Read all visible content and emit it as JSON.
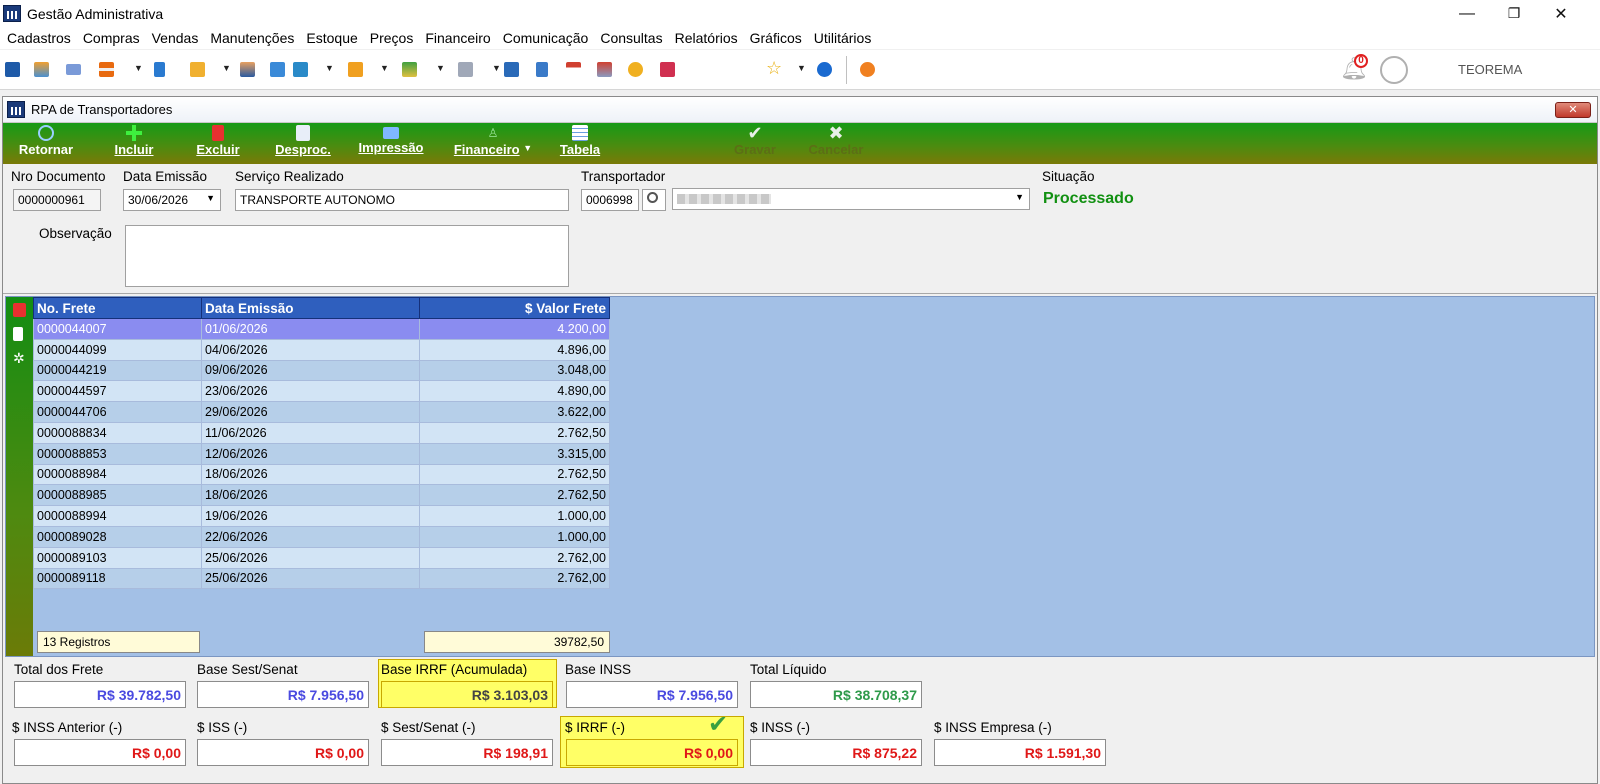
{
  "window": {
    "title": "Gestão Administrativa",
    "min": "—",
    "restore": "❐",
    "close": "✕"
  },
  "menu": [
    "Cadastros",
    "Compras",
    "Vendas",
    "Manutenções",
    "Estoque",
    "Preços",
    "Financeiro",
    "Comunicação",
    "Consultas",
    "Relatórios",
    "Gráficos",
    "Utilitários"
  ],
  "toolbar": {
    "notification_count": "0",
    "user_name": "TEOREMA"
  },
  "form_window": {
    "title": "RPA de Transportadores",
    "close": "✕"
  },
  "actions": {
    "retornar": "Retornar",
    "incluir": "Incluir",
    "excluir": "Excluir",
    "desproc": "Desproc.",
    "impressao": "Impressão",
    "financeiro": "Financeiro",
    "tabela": "Tabela",
    "gravar": "Gravar",
    "cancelar": "Cancelar"
  },
  "form": {
    "nro_documento_label": "Nro Documento",
    "nro_documento": "0000000961",
    "data_emissao_label": "Data Emissão",
    "data_emissao": "30/06/2026",
    "servico_label": "Serviço Realizado",
    "servico": "TRANSPORTE AUTONOMO",
    "transportador_label": "Transportador",
    "transportador_codigo": "0006998",
    "situacao_label": "Situação",
    "situacao": "Processado",
    "observacao_label": "Observação"
  },
  "grid": {
    "columns": [
      "No. Frete",
      "Data Emissão",
      "$ Valor Frete"
    ],
    "rows": [
      [
        "0000044007",
        "01/06/2026",
        "4.200,00"
      ],
      [
        "0000044099",
        "04/06/2026",
        "4.896,00"
      ],
      [
        "0000044219",
        "09/06/2026",
        "3.048,00"
      ],
      [
        "0000044597",
        "23/06/2026",
        "4.890,00"
      ],
      [
        "0000044706",
        "29/06/2026",
        "3.622,00"
      ],
      [
        "0000088834",
        "11/06/2026",
        "2.762,50"
      ],
      [
        "0000088853",
        "12/06/2026",
        "3.315,00"
      ],
      [
        "0000088984",
        "18/06/2026",
        "2.762,50"
      ],
      [
        "0000088985",
        "18/06/2026",
        "2.762,50"
      ],
      [
        "0000088994",
        "19/06/2026",
        "1.000,00"
      ],
      [
        "0000089028",
        "22/06/2026",
        "1.000,00"
      ],
      [
        "0000089103",
        "25/06/2026",
        "2.762,00"
      ],
      [
        "0000089118",
        "25/06/2026",
        "2.762,00"
      ]
    ],
    "footer_count": "13 Registros",
    "footer_total": "39782,50"
  },
  "totals": {
    "total_frete_label": "Total dos Frete",
    "total_frete": "R$ 39.782,50",
    "base_sest_label": "Base Sest/Senat",
    "base_sest": "R$ 7.956,50",
    "base_irrf_label": "Base IRRF (Acumulada)",
    "base_irrf": "R$ 3.103,03",
    "base_inss_label": "Base INSS",
    "base_inss": "R$ 7.956,50",
    "total_liquido_label": "Total Líquido",
    "total_liquido": "R$ 38.708,37",
    "inss_anterior_label": "$ INSS Anterior (-)",
    "inss_anterior": "R$ 0,00",
    "iss_label": "$ ISS (-)",
    "iss": "R$ 0,00",
    "sest_label": "$ Sest/Senat (-)",
    "sest": "R$ 198,91",
    "irrf_label": "$ IRRF (-)",
    "irrf": "R$ 0,00",
    "inss_label": "$ INSS (-)",
    "inss": "R$ 875,22",
    "inss_empresa_label": "$ INSS Empresa (-)",
    "inss_empresa": "R$ 1.591,30"
  },
  "colors": {
    "value_blue": "#4a4ae0",
    "value_green": "#2e9a4a",
    "value_red": "#e01818",
    "status_green": "#119011"
  }
}
